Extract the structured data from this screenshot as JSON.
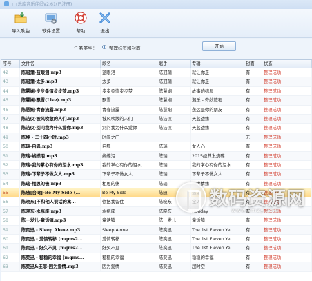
{
  "window": {
    "title": "□ 乐库音乐伴侣V2.61(已注册)"
  },
  "toolbar": {
    "buttons": [
      {
        "label": "导入歌曲",
        "icon": "import-folder-icon"
      },
      {
        "label": "软件设置",
        "icon": "settings-icon"
      },
      {
        "label": "帮助",
        "icon": "lifebuoy-help-icon"
      },
      {
        "label": "退出",
        "icon": "close-x-icon"
      }
    ]
  },
  "task": {
    "label": "任务类型：",
    "option": "整理标签和封面",
    "start_button": "开始"
  },
  "table": {
    "columns": [
      "序号",
      "文件名",
      "歌名",
      "歌手",
      "专辑",
      "封面",
      "状态"
    ],
    "rows": [
      [
        "42",
        "陈冠蒲-蓝眼泪.mp3",
        "蓝眼泪",
        "陈冠蒲",
        "就让你走",
        "有",
        "整理成功"
      ],
      [
        "43",
        "陈冠蒲-太多.mp3",
        "太多",
        "陈冠蒲",
        "就让你走",
        "有",
        "整理成功"
      ],
      [
        "44",
        "陈慧娴-步步柔情步步梦.mp3",
        "步步柔情步步梦",
        "陈慧娴",
        "故事的结局",
        "有",
        "整理成功"
      ],
      [
        "45",
        "陈慧娴-飘雪(Live).mp3",
        "飘雪",
        "陈慧娴",
        "潮乐 - 奇妙旅程",
        "有",
        "整理成功"
      ],
      [
        "46",
        "陈慧娴-青春流露.mp3",
        "青春流露",
        "陈慧娴",
        "永远是你的朋友",
        "有",
        "整理成功"
      ],
      [
        "47",
        "陈洁仪-被风吹散的人们.mp3",
        "被风吹散的人们",
        "陈洁仪",
        "天蓝边缘",
        "有",
        "整理成功"
      ],
      [
        "48",
        "陈洁仪-别问我为什么爱你.mp3",
        "别问我为什么爱你",
        "陈洁仪",
        "天蓝边缘",
        "有",
        "整理成功"
      ],
      [
        "49",
        "陈坤 - 二十四小时.mp3",
        "时间之门",
        "",
        "",
        "无",
        "整理成功"
      ],
      [
        "50",
        "陈瑞-白狐.mp3",
        "白狐",
        "陈瑞",
        "女人心",
        "有",
        "整理成功"
      ],
      [
        "51",
        "陈瑞-蝴蝶泪.mp3",
        "蝴蝶泪",
        "陈瑞",
        "2015经典发烧碟",
        "有",
        "整理成功"
      ],
      [
        "52",
        "陈瑞-我的掌心有你的泪水.mp3",
        "我的掌心有你的泪水",
        "陈瑞",
        "我的掌心有你的泪水",
        "有",
        "整理成功"
      ],
      [
        "53",
        "陈瑞-下辈子不做女人.mp3",
        "下辈子不做女人",
        "陈瑞",
        "下辈子不做女人",
        "有",
        "整理成功"
      ],
      [
        "54",
        "陈瑞-相思的债.mp3",
        "相思的债",
        "陈瑞",
        "一世情缘",
        "有",
        "整理成功"
      ],
      [
        "55",
        "陈随[台湾]-Be My Side (...",
        "Be My Side",
        "陈随",
        "遇见",
        "有",
        "整理成功"
      ],
      [
        "56",
        "陈晓东[不和他人说话的寓...",
        "你把我留住",
        "陈晓东",
        "宝贝",
        "有",
        "整理成功"
      ],
      [
        "57",
        "陈晓东-水瓶座.mp3",
        "水瓶座",
        "陈晓东",
        "Holiday",
        "有",
        "整理成功"
      ],
      [
        "58",
        "陈一发儿-童话镇.mp3",
        "童话镇",
        "陈一发儿",
        "童话镇",
        "有",
        "整理成功"
      ],
      [
        "59",
        "陈奕迅 - Sleep Alone.mp3",
        "Sleep Alone",
        "陈奕迅",
        "The 1st Eleven Ye...",
        "有",
        "整理成功"
      ],
      [
        "60",
        "陈奕迅 - 爱情转移 [mqms2...",
        "爱情转移",
        "陈奕迅",
        "The 1st Eleven Ye...",
        "有",
        "整理成功"
      ],
      [
        "61",
        "陈奕迅 - 好久不见 [mqms2...",
        "好久不见",
        "陈奕迅",
        "The 1st Eleven Ye...",
        "有",
        "整理成功"
      ],
      [
        "62",
        "陈奕迅 - 稳稳的幸福 [mqms...",
        "稳稳的幸福",
        "陈奕迅",
        "稳稳的幸福",
        "有",
        "整理成功"
      ],
      [
        "63",
        "陈奕迅&王菲-因为爱情.mp3",
        "因为爱情",
        "陈奕迅",
        "超时空",
        "有",
        "整理成功"
      ]
    ],
    "selected_index": 13
  },
  "watermark": {
    "text": "数码资源网",
    "url": "www.smzy.com"
  },
  "colors": {
    "accent": "#2e6db4",
    "status": "#d23a2a",
    "selected": "#ffd98a"
  }
}
